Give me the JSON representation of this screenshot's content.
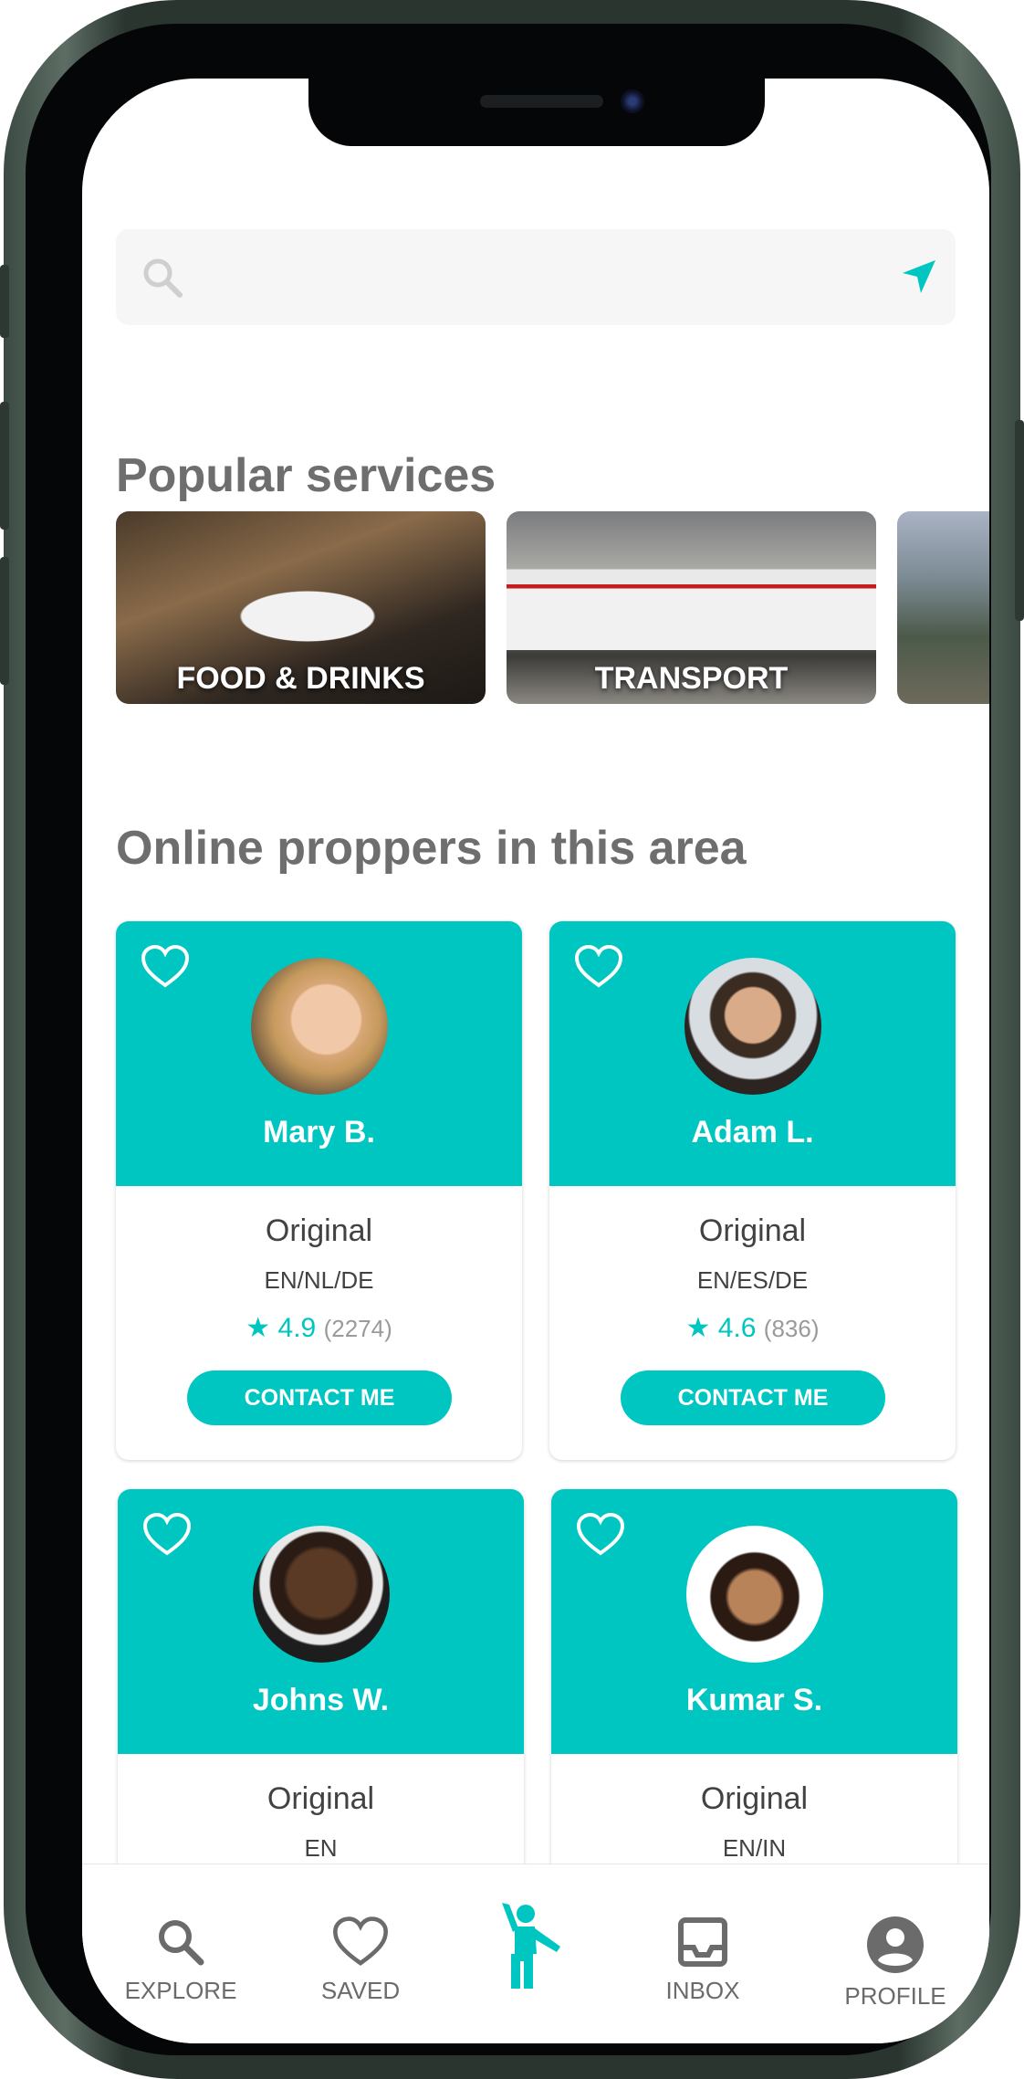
{
  "search": {
    "placeholder": "",
    "value": ""
  },
  "sections": {
    "popular_title": "Popular services",
    "online_title": "Online proppers in this area"
  },
  "services": [
    {
      "label": "FOOD & DRINKS"
    },
    {
      "label": "TRANSPORT"
    },
    {
      "label": ""
    }
  ],
  "proppers": [
    {
      "name": "Mary B.",
      "tier": "Original",
      "languages": "EN/NL/DE",
      "rating": "4.9",
      "reviews": "(2274)",
      "contact": "CONTACT ME"
    },
    {
      "name": "Adam L.",
      "tier": "Original",
      "languages": "EN/ES/DE",
      "rating": "4.6",
      "reviews": "(836)",
      "contact": "CONTACT ME"
    },
    {
      "name": "Johns W.",
      "tier": "Original",
      "languages": "EN"
    },
    {
      "name": "Kumar S.",
      "tier": "Original",
      "languages": "EN/IN"
    }
  ],
  "tabbar": {
    "explore": "EXPLORE",
    "saved": "SAVED",
    "inbox": "INBOX",
    "profile": "PROFILE"
  },
  "colors": {
    "accent": "#00c6c2",
    "heading": "#6e6e6e",
    "text": "#424242"
  }
}
